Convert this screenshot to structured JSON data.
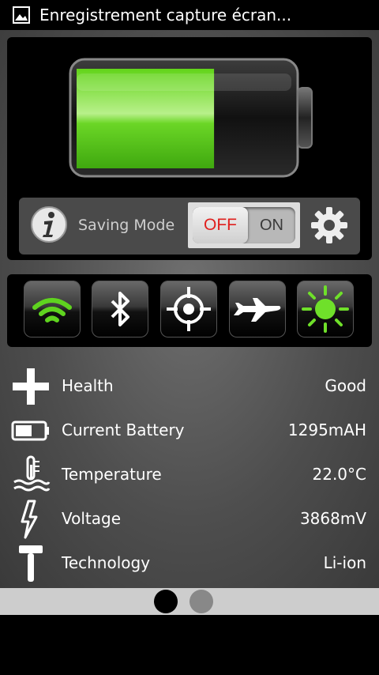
{
  "status_bar": {
    "title": "Enregistrement capture écran...",
    "icon": "image-icon"
  },
  "battery": {
    "level_fraction": 0.64,
    "fill_color": "#5fd31f"
  },
  "saving_mode": {
    "label": "Saving Mode",
    "toggle_off": "OFF",
    "toggle_on": "ON",
    "state": "OFF"
  },
  "quick_toggles": [
    {
      "name": "wifi",
      "icon": "wifi-icon",
      "active": true
    },
    {
      "name": "bluetooth",
      "icon": "bluetooth-icon",
      "active": false
    },
    {
      "name": "gps",
      "icon": "crosshair-icon",
      "active": false
    },
    {
      "name": "airplane",
      "icon": "airplane-icon",
      "active": false
    },
    {
      "name": "brightness",
      "icon": "sun-icon",
      "active": true
    }
  ],
  "info": [
    {
      "label": "Health",
      "value": "Good",
      "icon": "plus-icon"
    },
    {
      "label": "Current Battery",
      "value": "1295mAH",
      "icon": "battery-icon"
    },
    {
      "label": "Temperature",
      "value": "22.0°C",
      "icon": "thermometer-icon"
    },
    {
      "label": "Voltage",
      "value": "3868mV",
      "icon": "lightning-icon"
    },
    {
      "label": "Technology",
      "value": "Li-ion",
      "icon": "hammer-icon"
    }
  ],
  "pager": {
    "pages": 2,
    "current": 1
  },
  "colors": {
    "accent_green": "#5fd31f",
    "toggle_off_red": "#e0201e"
  }
}
